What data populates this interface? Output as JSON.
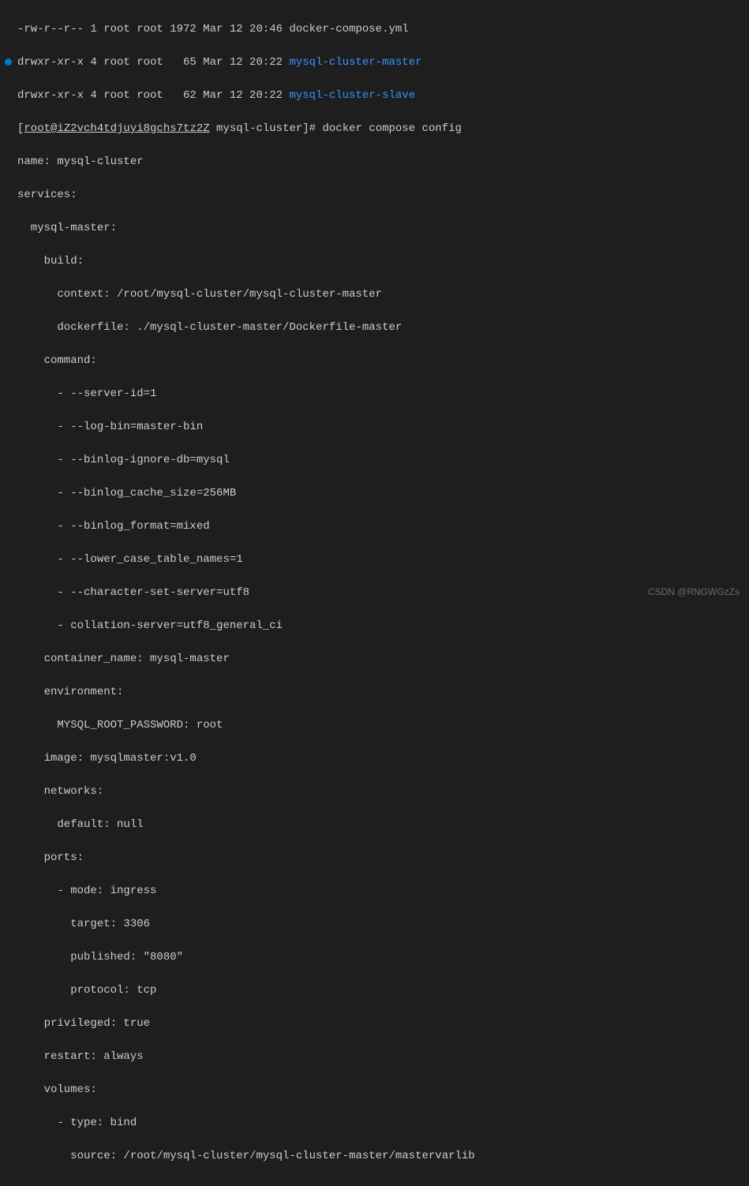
{
  "listing": {
    "row0": "-rw-r--r-- 1 root root 1972 Mar 12 20:46 docker-compose.yml",
    "row1_prefix": "drwxr-xr-x 4 root root   65 Mar 12 20:22 ",
    "row1_name": "mysql-cluster-master",
    "row2_prefix": "drwxr-xr-x 4 root root   62 Mar 12 20:22 ",
    "row2_name": "mysql-cluster-slave"
  },
  "prompt": {
    "lbracket": "[",
    "host": "root@iZ2vch4tdjuyi8gchs7tz2Z",
    "cwd": " mysql-cluster]# ",
    "command": "docker compose config"
  },
  "config": {
    "l0": "name: mysql-cluster",
    "l1": "services:",
    "l2": "  mysql-master:",
    "l3": "    build:",
    "l4": "      context: /root/mysql-cluster/mysql-cluster-master",
    "l5": "      dockerfile: ./mysql-cluster-master/Dockerfile-master",
    "l6": "    command:",
    "l7": "      - --server-id=1",
    "l8": "      - --log-bin=master-bin",
    "l9": "      - --binlog-ignore-db=mysql",
    "l10": "      - --binlog_cache_size=256MB",
    "l11": "      - --binlog_format=mixed",
    "l12": "      - --lower_case_table_names=1",
    "l13": "      - --character-set-server=utf8",
    "l14": "      - collation-server=utf8_general_ci",
    "l15": "    container_name: mysql-master",
    "l16": "    environment:",
    "l17": "      MYSQL_ROOT_PASSWORD: root",
    "l18": "    image: mysqlmaster:v1.0",
    "l19": "    networks:",
    "l20": "      default: null",
    "l21": "    ports:",
    "l22": "      - mode: ingress",
    "l23": "        target: 3306",
    "l24": "        published: \"8080\"",
    "l25": "        protocol: tcp",
    "l26": "    privileged: true",
    "l27": "    restart: always",
    "l28": "    volumes:",
    "l29": "      - type: bind",
    "l30": "        source: /root/mysql-cluster/mysql-cluster-master/mastervarlib"
  },
  "watermark": "CSDN @RNGWGzZs"
}
